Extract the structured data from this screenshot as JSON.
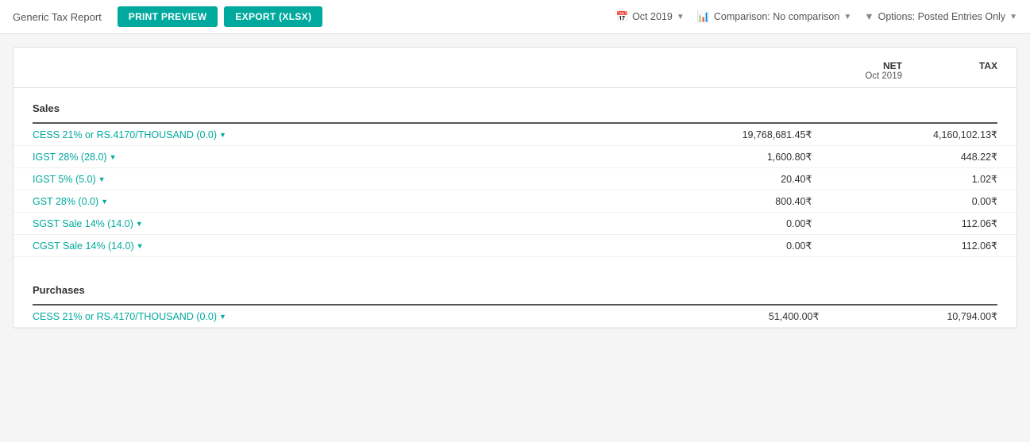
{
  "page": {
    "title": "Generic Tax Report"
  },
  "toolbar": {
    "print_preview": "PRINT PREVIEW",
    "export_xlsx": "EXPORT (XLSX)"
  },
  "filters": {
    "date": "Oct 2019",
    "comparison": "Comparison: No comparison",
    "options": "Options: Posted Entries Only"
  },
  "report": {
    "col_net_label": "NET",
    "col_net_sub": "Oct 2019",
    "col_tax_label": "TAX"
  },
  "sections": [
    {
      "title": "Sales",
      "rows": [
        {
          "name": "CESS 21% or RS.4170/THOUSAND (0.0)",
          "net": "19,768,681.45₹",
          "tax": "4,160,102.13₹"
        },
        {
          "name": "IGST 28% (28.0)",
          "net": "1,600.80₹",
          "tax": "448.22₹"
        },
        {
          "name": "IGST 5% (5.0)",
          "net": "20.40₹",
          "tax": "1.02₹"
        },
        {
          "name": "GST 28% (0.0)",
          "net": "800.40₹",
          "tax": "0.00₹"
        },
        {
          "name": "SGST Sale 14% (14.0)",
          "net": "0.00₹",
          "tax": "112.06₹"
        },
        {
          "name": "CGST Sale 14% (14.0)",
          "net": "0.00₹",
          "tax": "112.06₹"
        }
      ]
    },
    {
      "title": "Purchases",
      "rows": [
        {
          "name": "CESS 21% or RS.4170/THOUSAND (0.0)",
          "net": "51,400.00₹",
          "tax": "10,794.00₹"
        }
      ]
    }
  ]
}
